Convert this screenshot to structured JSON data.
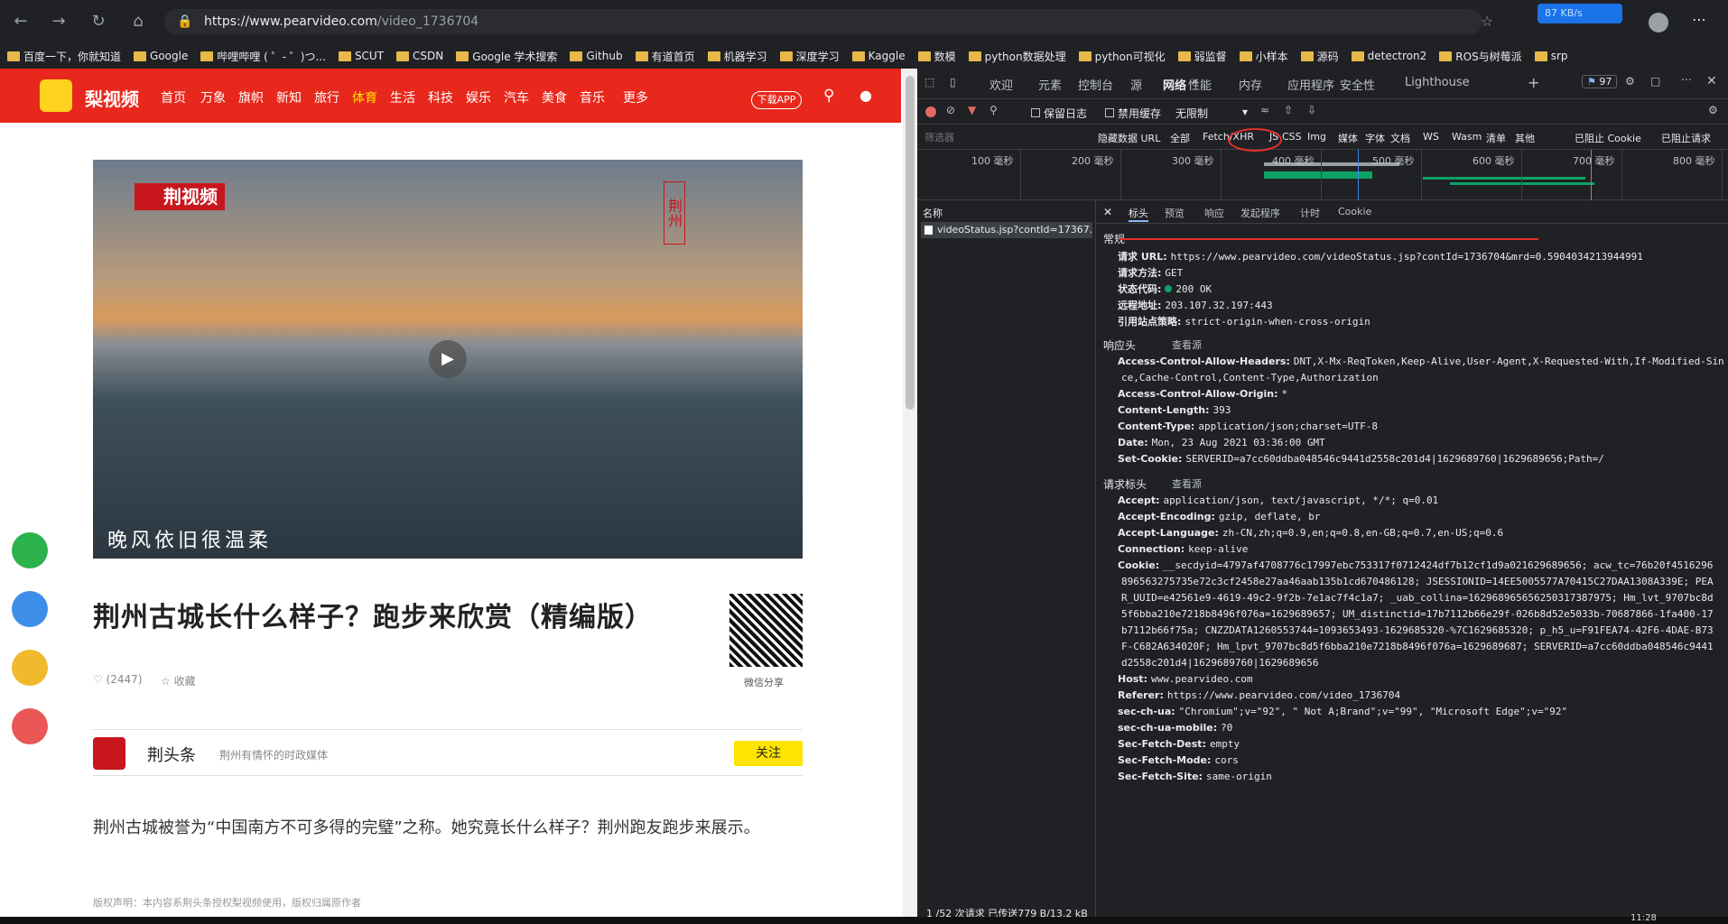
{
  "browser": {
    "url_host": "https://www.pearvideo.com",
    "url_path": "/video_1736704",
    "speed": "87 KB/s",
    "bookmarks": [
      "百度一下，你就知道",
      "Google",
      "哔哩哔哩 ( ゜- ゜)つ...",
      "SCUT",
      "CSDN",
      "Google 学术搜索",
      "Github",
      "有道首页",
      "机器学习",
      "深度学习",
      "Kaggle",
      "数模",
      "python数据处理",
      "python可视化",
      "弱监督",
      "小样本",
      "源码",
      "detectron2",
      "ROS与树莓派",
      "srp"
    ]
  },
  "site": {
    "logo": "梨视频",
    "nav": [
      "首页",
      "万象",
      "旗帜",
      "新知",
      "旅行",
      "体育",
      "生活",
      "科技",
      "娱乐",
      "汽车",
      "美食",
      "音乐",
      "更多"
    ],
    "download_app": "下载APP",
    "video_logo": "荆视频",
    "video_stamp": "荆州",
    "video_caption": "晚风依旧很温柔",
    "title": "荆州古城长什么样子？跑步来欣赏（精编版）",
    "likes": "(2447)",
    "favorite": "收藏",
    "wechat_share": "微信分享",
    "author": "荆头条",
    "author_desc": "荆州有情怀的时政媒体",
    "follow": "关注",
    "summary": "荆州古城被誉为“中国南方不可多得的完璧”之称。她究竟长什么样子？荆州跑友跑步来展示。",
    "copyright": "版权声明：本内容系荆头条授权梨视频使用，版权归属原作者"
  },
  "devtools": {
    "tabs": [
      "欢迎",
      "元素",
      "控制台",
      "源",
      "网络",
      "性能",
      "内存",
      "应用程序",
      "安全性",
      "Lighthouse"
    ],
    "issues": "97",
    "toolbar": {
      "preserve_log": "保留日志",
      "disable_cache": "禁用缓存",
      "throttle": "无限制"
    },
    "filter_placeholder": "筛选器",
    "filters": [
      "隐藏数据 URL",
      "全部",
      "Fetch/XHR",
      "JS",
      "CSS",
      "Img",
      "媒体",
      "字体",
      "文档",
      "WS",
      "Wasm",
      "清单",
      "其他",
      "已阻止 Cookie",
      "已阻止请求"
    ],
    "timeline": [
      "100 毫秒",
      "200 毫秒",
      "300 毫秒",
      "400 毫秒",
      "500 毫秒",
      "600 毫秒",
      "700 毫秒",
      "800 毫秒"
    ],
    "name_header": "名称",
    "request_name": "videoStatus.jsp?contId=17367...",
    "status_bar": "1 /52 次请求  已传送779 B/13.2 kB",
    "detail_tabs": [
      "标头",
      "预览",
      "响应",
      "发起程序",
      "计时",
      "Cookie"
    ],
    "general_title": "常规",
    "general": [
      {
        "k": "请求 URL:",
        "v": "https://www.pearvideo.com/videoStatus.jsp?contId=1736704&mrd=0.5904034213944991"
      },
      {
        "k": "请求方法:",
        "v": "GET"
      },
      {
        "k": "状态代码:",
        "v": "200 OK"
      },
      {
        "k": "远程地址:",
        "v": "203.107.32.197:443"
      },
      {
        "k": "引用站点策略:",
        "v": "strict-origin-when-cross-origin"
      }
    ],
    "response_title": "响应头",
    "view_source": "查看源",
    "response": [
      {
        "k": "Access-Control-Allow-Headers:",
        "v": "DNT,X-Mx-ReqToken,Keep-Alive,User-Agent,X-Requested-With,If-Modified-Sin"
      },
      {
        "k": "",
        "v": "ce,Cache-Control,Content-Type,Authorization"
      },
      {
        "k": "Access-Control-Allow-Origin:",
        "v": "*"
      },
      {
        "k": "Content-Length:",
        "v": "393"
      },
      {
        "k": "Content-Type:",
        "v": "application/json;charset=UTF-8"
      },
      {
        "k": "Date:",
        "v": "Mon, 23 Aug 2021 03:36:00 GMT"
      },
      {
        "k": "Set-Cookie:",
        "v": "SERVERID=a7cc60ddba048546c9441d2558c201d4|1629689760|1629689656;Path=/"
      }
    ],
    "request_title": "请求标头",
    "request": [
      {
        "k": "Accept:",
        "v": "application/json, text/javascript, */*; q=0.01"
      },
      {
        "k": "Accept-Encoding:",
        "v": "gzip, deflate, br"
      },
      {
        "k": "Accept-Language:",
        "v": "zh-CN,zh;q=0.9,en;q=0.8,en-GB;q=0.7,en-US;q=0.6"
      },
      {
        "k": "Connection:",
        "v": "keep-alive"
      },
      {
        "k": "Cookie:",
        "v": "__secdyid=4797af4708776c17997ebc753317f0712424df7b12cf1d9a021629689656; acw_tc=76b20f4516296"
      },
      {
        "k": "",
        "v": "896563275735e72c3cf2458e27aa46aab135b1cd670486128; JSESSIONID=14EE5005577A70415C27DAA1308A339E; PEA"
      },
      {
        "k": "",
        "v": "R_UUID=e42561e9-4619-49c2-9f2b-7e1ac7f4c1a7; _uab_collina=162968965656250317387975; Hm_lvt_9707bc8d"
      },
      {
        "k": "",
        "v": "5f6bba210e7218b8496f076a=1629689657; UM_distinctid=17b7112b66e29f-026b8d52e5033b-70687866-1fa400-17"
      },
      {
        "k": "",
        "v": "b7112b66f75a; CNZZDATA1260553744=1093653493-1629685320-%7C1629685320; p_h5_u=F91FEA74-42F6-4DAE-B73"
      },
      {
        "k": "",
        "v": "F-C682A634020F; Hm_lpvt_9707bc8d5f6bba210e7218b8496f076a=1629689687; SERVERID=a7cc60ddba048546c9441"
      },
      {
        "k": "",
        "v": "d2558c201d4|1629689760|1629689656"
      },
      {
        "k": "Host:",
        "v": "www.pearvideo.com"
      },
      {
        "k": "Referer:",
        "v": "https://www.pearvideo.com/video_1736704"
      },
      {
        "k": "sec-ch-ua:",
        "v": "\"Chromium\";v=\"92\", \" Not A;Brand\";v=\"99\", \"Microsoft Edge\";v=\"92\""
      },
      {
        "k": "sec-ch-ua-mobile:",
        "v": "?0"
      },
      {
        "k": "Sec-Fetch-Dest:",
        "v": "empty"
      },
      {
        "k": "Sec-Fetch-Mode:",
        "v": "cors"
      },
      {
        "k": "Sec-Fetch-Site:",
        "v": "same-origin"
      }
    ]
  },
  "taskbar": {
    "time": "11:28"
  }
}
